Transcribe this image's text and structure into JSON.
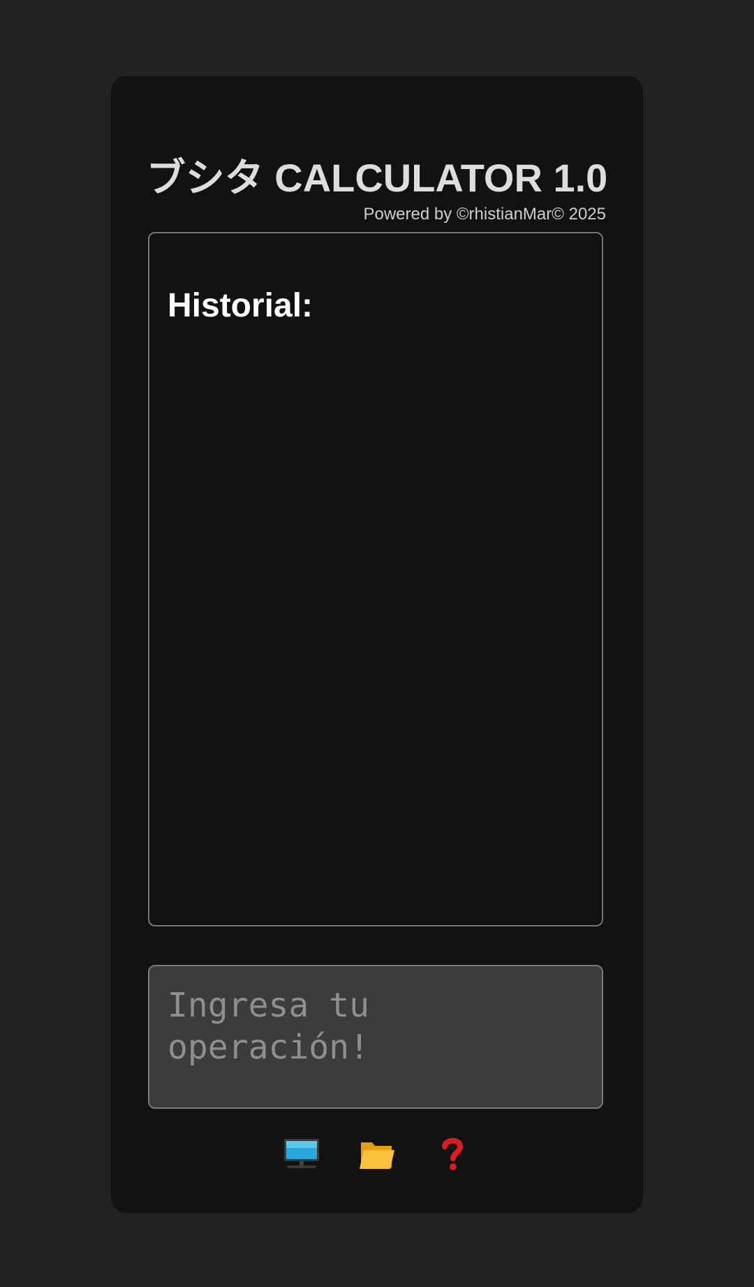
{
  "header": {
    "title": "ブシタ CALCULATOR 1.0",
    "credit": "Powered by ©rhistianMar© 2025"
  },
  "history": {
    "heading": "Historial:"
  },
  "input": {
    "value": "",
    "placeholder": "Ingresa tu operación!"
  },
  "toolbar": {
    "buttons": [
      {
        "icon": "computer-icon"
      },
      {
        "icon": "folder-icon"
      },
      {
        "icon": "question-icon"
      }
    ]
  },
  "colors": {
    "page_background": "#222222",
    "card_background": "#121212",
    "input_background": "#3c3c3c",
    "border": "#777777",
    "question_red": "#d81e1e",
    "folder_yellow": "#f5b324",
    "screen_blue": "#2aa7d8"
  }
}
